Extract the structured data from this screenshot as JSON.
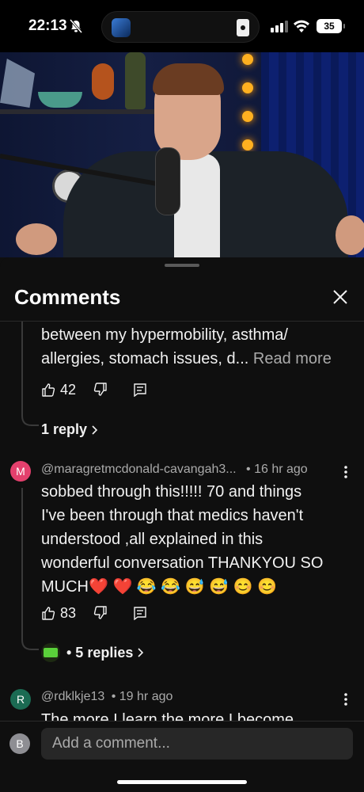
{
  "status_bar": {
    "time": "22:13",
    "battery": "35"
  },
  "video": {
    "progress_fraction": 0.0
  },
  "sheet": {
    "title": "Comments"
  },
  "comments": [
    {
      "text_line1": "between my hypermobility, asthma/",
      "text_line2": "allergies, stomach issues, d...",
      "read_more": "Read more",
      "likes": "42",
      "replies_label": "1 reply"
    },
    {
      "avatar_letter": "M",
      "avatar_color": "#e4406d",
      "author": "@maragretmcdonald-cavangah3...",
      "time": "• 16 hr ago",
      "text_line1": "sobbed through this!!!!! 70 and things",
      "text_line2": "I've  been through that medics haven't",
      "text_line3": "understood ,all  explained in this",
      "text_line4": "wonderful conversation THANKYOU  SO",
      "text_line5": "MUCH❤️ ❤️ 😂 😂 😅 😅 😊 😊",
      "likes": "83",
      "replies_label": "• 5 replies"
    },
    {
      "avatar_letter": "R",
      "avatar_color": "#1b6b53",
      "author": "@rdklkje13",
      "time": "• 19 hr ago",
      "text_line1": "The more I learn the more I become"
    }
  ],
  "composer": {
    "avatar_letter": "B",
    "placeholder": "Add a comment..."
  }
}
